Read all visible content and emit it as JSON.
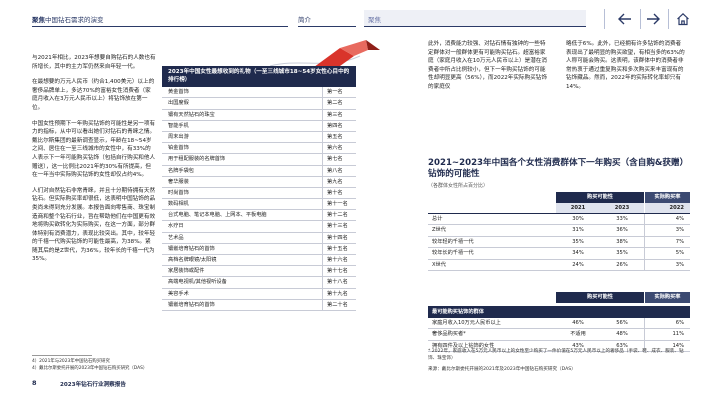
{
  "header": {
    "breadcrumb_bold": "聚焦",
    "breadcrumb_rest": "中国钻石需求的演变",
    "tab_intro": "简介",
    "tab_focus": "聚焦"
  },
  "icons": {
    "back": "arrow-left-icon",
    "forward": "arrow-right-icon",
    "home": "home-icon"
  },
  "left_paragraphs": [
    "与2021年相比，2023年想要自购钻石的人数也有所增长，其中的主力军仍然来自年轻一代。",
    "在最想要的万元人民币（约合1,400美元）以上的奢侈品牌单上，多达70%的富裕女性消费者（家庭月收入在3万元人民币以上）将钻饰放在第一位。",
    "中国女性预期下一年购买钻饰的可能性是另一项有力的指标，从中可以看出她们对钻石的青睐之情。戴比尔斯集团的最新调查显示，年龄在18~54岁之间、居住在一至三线城市的女性中，有33%的人表示下一年可能购买钻饰（包括自行购买和他人赠送），这一比例比2021年的30%有所提高，但在一年当中实际购买钻饰的女性却仅占约4%。",
    "人们对自然钻石非常青睐，并且十分期待拥有天然钻石。但实际购买率却很低，这表明中国钻饰的品类尚未得到充分发展。本报告面向零售商、珠宝制造商和整个钻石行业，旨在帮助他们在中国更有效地将购买欲转化为实际购买，在这一方面，部分群体特别有消费潜力，表现比较突出。其中，较年轻的千禧一代购买钻饰的可能性最高，为38%。紧随其后的是Z世代，为36%，较年长的千禧一代为35%。"
  ],
  "rank_table": {
    "title": "2023年中国女性最想收到的礼物（一至三线城市18~54岁女性心目中的排行榜）",
    "items": [
      [
        "黄金首饰",
        "第一名"
      ],
      [
        "出国度假",
        "第二名"
      ],
      [
        "镶有天然钻石的珠宝",
        "第三名"
      ],
      [
        "智能手机",
        "第四名"
      ],
      [
        "周末出游",
        "第五名"
      ],
      [
        "铂金首饰",
        "第六名"
      ],
      [
        "用于租配服装的名牌首饰",
        "第七名"
      ],
      [
        "名牌手袋包",
        "第八名"
      ],
      [
        "奢华服装",
        "第九名"
      ],
      [
        "时尚首饰",
        "第十名"
      ],
      [
        "数码相机",
        "第十一名"
      ],
      [
        "台式电脑、笔记本电脑、上网本、平板电脑",
        "第十二名"
      ],
      [
        "水疗日",
        "第十三名"
      ],
      [
        "艺术品",
        "第十四名"
      ],
      [
        "镶嵌培育钻石的首饰",
        "第十五名"
      ],
      [
        "高档名牌眼镜/太阳镜",
        "第十六名"
      ],
      [
        "家居装饰或配件",
        "第十七名"
      ],
      [
        "高端电视机/其他视听设备",
        "第十八名"
      ],
      [
        "美容手术",
        "第十九名"
      ],
      [
        "镶嵌培育钻石的首饰",
        "第二十名"
      ]
    ]
  },
  "right_col1": "此外，消费能力较强、对钻石情有独钟的一些特定群体对一般群体更有可能购买钻石。超富裕家庭（家庭月收入在10万元人民币以上）是潜在消费者中所占比例较小，但下一年购买钻饰的可能性却明显更高（56%），而2022年实际购买钻饰的家庭仅",
  "right_col2": "略低于6%。此外，已经拥有许多钻饰的消费者表现出了最明显的购买欲望，有相当多的63%的人称可能会购买。这表明，该群体中的消费者非常热衷于通过重复购买和多次购买来丰富现有的钻饰藏品。然而，2022年的实际转化率却只有14%。",
  "chart": {
    "title": "2021~2023年中国各个女性消费群体下一年购买（含自购&获赠）钻饰的可能性",
    "subtitle": "（各群体女性所占百分比）",
    "group1": "购买可能性",
    "group2": "实际购买率",
    "years": [
      "2021",
      "2023",
      "2022"
    ],
    "rows": [
      [
        "总计",
        "30%",
        "33%",
        "4%"
      ],
      [
        "Z世代",
        "31%",
        "36%",
        "3%"
      ],
      [
        "较年轻的千禧一代",
        "35%",
        "38%",
        "7%"
      ],
      [
        "较年长的千禧一代",
        "34%",
        "35%",
        "5%"
      ],
      [
        "X世代",
        "24%",
        "26%",
        "3%"
      ]
    ],
    "sub_header": "最可能购买钻饰的群体",
    "sub_rows": [
      [
        "家庭月收入10万元人民币以上",
        "46%",
        "56%",
        "6%"
      ],
      [
        "奢侈品购买者*",
        "不适用",
        "48%",
        "11%"
      ],
      [
        "拥有四件及以上钻饰的女性",
        "43%",
        "63%",
        "14%"
      ]
    ]
  },
  "footnote_star": "* 2022年，家庭收入在5万元人民币以上的女性至少购买了一件价值在5万元人民币以上的奢侈品（手袋、鞋、成衣、服装、钻饰、珠宝饰）",
  "source": "来源：戴比尔斯委托开展的2021年及2023年中国钻石购买研究（DAS）",
  "left_footnotes": [
    "4）2021年与2023年中国钻石购买研究",
    "4）戴比尔斯委托开展的2023年中国钻石购买研究（DAS）"
  ],
  "page_number": "8",
  "report_title": "2023年钻石行业洞察报告"
}
